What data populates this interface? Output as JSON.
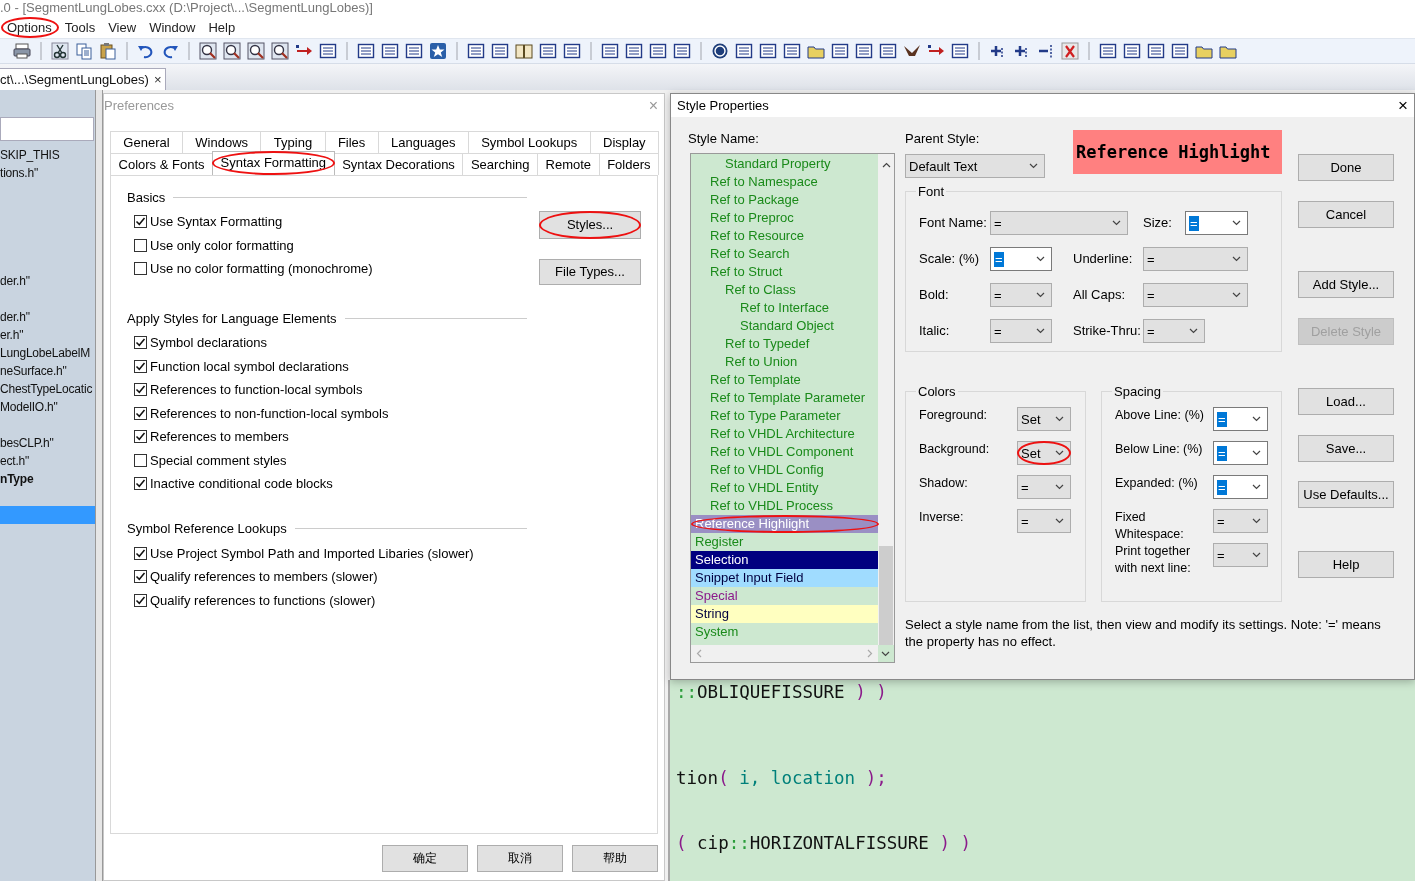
{
  "window": {
    "title": ".0 - [SegmentLungLobes.cxx (D:\\Project\\...\\SegmentLungLobes)]"
  },
  "menu": [
    {
      "label": "Options",
      "circled": true
    },
    {
      "label": "Tools",
      "circled": false
    },
    {
      "label": "View",
      "circled": false
    },
    {
      "label": "Window",
      "circled": false
    },
    {
      "label": "Help",
      "circled": false
    }
  ],
  "document_tab": {
    "label": "ct\\...\\SegmentLungLobes)",
    "close": "×"
  },
  "file_panel": {
    "lines": [
      {
        "kind": "text",
        "text": "SKIP_THIS",
        "bold": false,
        "selected": false
      },
      {
        "kind": "text",
        "text": "tions.h\"",
        "bold": false,
        "selected": false
      },
      {
        "kind": "blank"
      },
      {
        "kind": "blank"
      },
      {
        "kind": "blank"
      },
      {
        "kind": "blank"
      },
      {
        "kind": "blank"
      },
      {
        "kind": "text",
        "text": "der.h\"",
        "bold": false,
        "selected": false
      },
      {
        "kind": "blank"
      },
      {
        "kind": "text",
        "text": "der.h\"",
        "bold": false,
        "selected": false
      },
      {
        "kind": "text",
        "text": "er.h\"",
        "bold": false,
        "selected": false
      },
      {
        "kind": "text",
        "text": "LungLobeLabelM",
        "bold": false,
        "selected": false
      },
      {
        "kind": "text",
        "text": "neSurface.h\"",
        "bold": false,
        "selected": false
      },
      {
        "kind": "text",
        "text": "ChestTypeLocatic",
        "bold": false,
        "selected": false
      },
      {
        "kind": "text",
        "text": "ModelIO.h\"",
        "bold": false,
        "selected": false
      },
      {
        "kind": "blank"
      },
      {
        "kind": "text",
        "text": "besCLP.h\"",
        "bold": false,
        "selected": false
      },
      {
        "kind": "text",
        "text": "ect.h\"",
        "bold": false,
        "selected": false
      },
      {
        "kind": "text",
        "text": "nType",
        "bold": true,
        "selected": false
      },
      {
        "kind": "blank"
      },
      {
        "kind": "blank",
        "selected": true
      }
    ]
  },
  "preferences": {
    "title": "Preferences",
    "close": "×",
    "tab_rows": [
      [
        {
          "label": "General",
          "selected": false,
          "circled": false
        },
        {
          "label": "Windows",
          "selected": false,
          "circled": false
        },
        {
          "label": "Typing",
          "selected": false,
          "circled": false
        },
        {
          "label": "Files",
          "selected": false,
          "circled": false
        },
        {
          "label": "Languages",
          "selected": false,
          "circled": false
        },
        {
          "label": "Symbol Lookups",
          "selected": false,
          "circled": false
        },
        {
          "label": "Display",
          "selected": false,
          "circled": false
        }
      ],
      [
        {
          "label": "Colors & Fonts",
          "selected": false,
          "circled": false
        },
        {
          "label": "Syntax Formatting",
          "selected": true,
          "circled": true
        },
        {
          "label": "Syntax Decorations",
          "selected": false,
          "circled": false
        },
        {
          "label": "Searching",
          "selected": false,
          "circled": false
        },
        {
          "label": "Remote",
          "selected": false,
          "circled": false
        },
        {
          "label": "Folders",
          "selected": false,
          "circled": false
        }
      ]
    ],
    "groups": [
      {
        "title": "Basics",
        "options": [
          {
            "label": "Use Syntax Formatting",
            "checked": true
          },
          {
            "label": "Use only color formatting",
            "checked": false
          },
          {
            "label": "Use no color formatting (monochrome)",
            "checked": false
          }
        ],
        "buttons": [
          {
            "label": "Styles...",
            "circled": true
          },
          {
            "label": "File Types...",
            "circled": false
          }
        ]
      },
      {
        "title": "Apply Styles for Language Elements",
        "options": [
          {
            "label": "Symbol declarations",
            "checked": true
          },
          {
            "label": "Function local symbol declarations",
            "checked": true
          },
          {
            "label": "References to function-local symbols",
            "checked": true
          },
          {
            "label": "References to non-function-local symbols",
            "checked": true
          },
          {
            "label": "References to members",
            "checked": true
          },
          {
            "label": "Special comment styles",
            "checked": false
          },
          {
            "label": "Inactive conditional code blocks",
            "checked": true
          }
        ]
      },
      {
        "title": "Symbol Reference Lookups",
        "options": [
          {
            "label": "Use Project Symbol Path and Imported Libaries (slower)",
            "checked": true
          },
          {
            "label": "Qualify references to members (slower)",
            "checked": true
          },
          {
            "label": "Qualify references to functions (slower)",
            "checked": true
          }
        ]
      }
    ],
    "buttons": [
      "确定",
      "取消",
      "帮助"
    ]
  },
  "style_properties": {
    "title": "Style Properties",
    "close": "×",
    "style_name_label": "Style Name:",
    "styles": [
      {
        "children": [
          {
            "children": [
              {
                "label": "Standard Property",
                "kind": "text",
                "selected": false,
                "color": "#1a8a1a"
              }
            ]
          },
          {
            "label": "Ref to Namespace",
            "kind": "text",
            "selected": false,
            "color": "#1a8a1a"
          },
          {
            "label": "Ref to Package",
            "kind": "text",
            "selected": false,
            "color": "#1a8a1a"
          },
          {
            "label": "Ref to Preproc",
            "kind": "text",
            "selected": false,
            "color": "#1a8a1a"
          },
          {
            "label": "Ref to Resource",
            "kind": "text",
            "selected": false,
            "color": "#1a8a1a"
          },
          {
            "label": "Ref to Search",
            "kind": "text",
            "selected": false,
            "color": "#1a8a1a"
          },
          {
            "label": "Ref to Struct",
            "kind": "text",
            "selected": false,
            "color": "#1a8a1a",
            "children": [
              {
                "label": "Ref to Class",
                "kind": "text",
                "selected": false,
                "color": "#1a8a1a",
                "children": [
                  {
                    "label": "Ref to Interface",
                    "kind": "text",
                    "selected": false,
                    "color": "#1a8a1a"
                  },
                  {
                    "label": "Standard Object",
                    "kind": "text",
                    "selected": false,
                    "color": "#1a8a1a"
                  }
                ]
              },
              {
                "label": "Ref to Typedef",
                "kind": "text",
                "selected": false,
                "color": "#1a8a1a"
              },
              {
                "label": "Ref to Union",
                "kind": "text",
                "selected": false,
                "color": "#1a8a1a"
              }
            ]
          },
          {
            "label": "Ref to Template",
            "kind": "text",
            "selected": false,
            "color": "#1a8a1a"
          },
          {
            "label": "Ref to Template Parameter",
            "kind": "text",
            "selected": false,
            "color": "#1a8a1a"
          },
          {
            "label": "Ref to Type Parameter",
            "kind": "text",
            "selected": false,
            "color": "#1a8a1a"
          },
          {
            "label": "Ref to VHDL Architecture",
            "kind": "text",
            "selected": false,
            "color": "#1a8a1a"
          },
          {
            "label": "Ref to VHDL Component",
            "kind": "text",
            "selected": false,
            "color": "#1a8a1a"
          },
          {
            "label": "Ref to VHDL Config",
            "kind": "text",
            "selected": false,
            "color": "#1a8a1a"
          },
          {
            "label": "Ref to VHDL Entity",
            "kind": "text",
            "selected": false,
            "color": "#1a8a1a"
          },
          {
            "label": "Ref to VHDL Process",
            "kind": "text",
            "selected": false,
            "color": "#1a8a1a"
          }
        ]
      },
      {
        "label": "Reference Highlight",
        "kind": "text",
        "selected": true,
        "circled": true
      },
      {
        "label": "Register",
        "kind": "text",
        "selected": false,
        "color": "#1a8a1a"
      },
      {
        "label": "Selection",
        "kind": "fill",
        "selected": false,
        "color": "#000080"
      },
      {
        "label": "Snippet Input Field",
        "kind": "fill",
        "selected": false,
        "color": "#a0dcff"
      },
      {
        "label": "Special",
        "kind": "text",
        "selected": false,
        "color": "#8b1a8b"
      },
      {
        "label": "String",
        "kind": "fill",
        "selected": false,
        "color": "#ffffc0"
      },
      {
        "label": "System",
        "kind": "text",
        "selected": false,
        "color": "#1a8a1a"
      }
    ],
    "parent_style": {
      "label": "Parent Style:",
      "value": "Default Text"
    },
    "preview": {
      "text": "Reference Highlight",
      "color": "#ff8080"
    },
    "font": {
      "title": "Font",
      "rows": [
        [
          {
            "label": "Font Name:",
            "value": "=",
            "highlighted": false
          },
          {
            "label": "Size:",
            "value": "=",
            "highlighted": true
          }
        ],
        [
          {
            "label": "Scale: (%)",
            "value": "=",
            "highlighted": true
          },
          {
            "label": "Underline:",
            "value": "=",
            "highlighted": false
          }
        ],
        [
          {
            "label": "Bold:",
            "value": "=",
            "highlighted": false
          },
          {
            "label": "All Caps:",
            "value": "=",
            "highlighted": false
          }
        ],
        [
          {
            "label": "Italic:",
            "value": "=",
            "highlighted": false
          },
          {
            "label": "Strike-Thru:",
            "value": "=",
            "highlighted": false
          }
        ]
      ]
    },
    "colors": {
      "title": "Colors",
      "fields": [
        {
          "label": "Foreground:",
          "value": "Set",
          "highlighted": false,
          "circled": false
        },
        {
          "label": "Background:",
          "value": "Set",
          "highlighted": false,
          "circled": true
        },
        {
          "label": "Shadow:",
          "value": "=",
          "highlighted": false,
          "circled": false
        },
        {
          "label": "Inverse:",
          "value": "=",
          "highlighted": false,
          "circled": false
        }
      ]
    },
    "spacing": {
      "title": "Spacing",
      "fields": [
        {
          "label": "Above Line: (%)",
          "value": "=",
          "highlighted": true
        },
        {
          "label": "Below Line: (%)",
          "value": "=",
          "highlighted": true
        },
        {
          "label": "Expanded: (%)",
          "value": "=",
          "highlighted": true
        },
        {
          "label": "Fixed Whitespace:",
          "value": "=",
          "highlighted": false
        },
        {
          "label": "Print together with next line:",
          "value": "=",
          "highlighted": false
        }
      ]
    },
    "note": "Select a style name from the list, then view and modify its settings. Note: '=' means the property has no effect.",
    "buttons": [
      {
        "label": "Done",
        "disabled": false
      },
      {
        "label": "Cancel",
        "disabled": false
      },
      {
        "label": "Add Style...",
        "disabled": false
      },
      {
        "label": "Delete Style",
        "disabled": true
      },
      {
        "label": "Load...",
        "disabled": false
      },
      {
        "label": "Save...",
        "disabled": false
      },
      {
        "label": "Use Defaults...",
        "disabled": false
      },
      {
        "label": "Help",
        "disabled": false
      }
    ]
  },
  "editor": {
    "lines": [
      {
        "kind": "code",
        "tokens": [
          {
            "text": "::",
            "kind": "scope"
          },
          {
            "text": "OBLIQUEFISSURE",
            "kind": "name"
          },
          {
            "text": " ) )",
            "kind": "paren"
          }
        ]
      },
      {
        "kind": "blank"
      },
      {
        "kind": "blank"
      },
      {
        "kind": "blank"
      },
      {
        "kind": "code",
        "tokens": [
          {
            "text": "tion",
            "kind": "name"
          },
          {
            "text": "(",
            "kind": "paren"
          },
          {
            "text": " i, location ",
            "kind": "param"
          },
          {
            "text": ");",
            "kind": "paren"
          }
        ]
      },
      {
        "kind": "blank"
      },
      {
        "kind": "blank"
      },
      {
        "kind": "code",
        "tokens": [
          {
            "text": "(",
            "kind": "paren"
          },
          {
            "text": " cip",
            "kind": "name"
          },
          {
            "text": "::",
            "kind": "scope"
          },
          {
            "text": "HORIZONTALFISSURE",
            "kind": "name"
          },
          {
            "text": " ) )",
            "kind": "paren"
          }
        ]
      }
    ]
  }
}
